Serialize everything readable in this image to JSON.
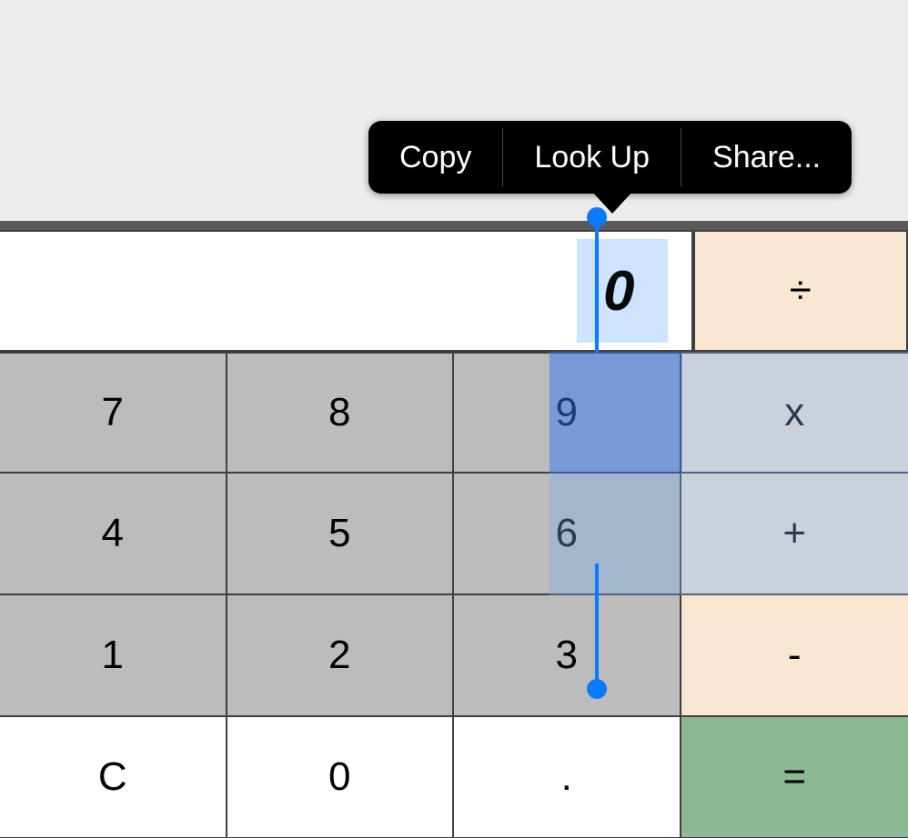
{
  "context_menu": {
    "items": [
      "Copy",
      "Look Up",
      "Share..."
    ]
  },
  "display": {
    "value": "0"
  },
  "operators": {
    "divide": "÷",
    "multiply": "x",
    "add": "+",
    "subtract": "-",
    "equals": "="
  },
  "keys": {
    "row1": [
      "7",
      "8",
      "9"
    ],
    "row2": [
      "4",
      "5",
      "6"
    ],
    "row3": [
      "1",
      "2",
      "3"
    ],
    "row4": [
      "C",
      "0",
      "."
    ]
  }
}
